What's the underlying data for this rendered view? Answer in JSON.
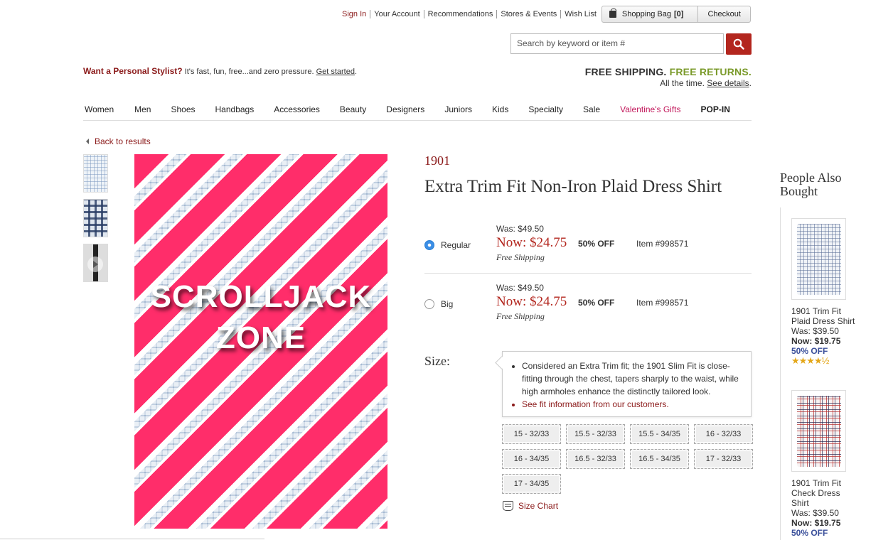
{
  "utility": {
    "links": [
      "Sign In",
      "Your Account",
      "Recommendations",
      "Stores & Events",
      "Wish List"
    ],
    "bag_label": "Shopping Bag",
    "bag_count": "[0]",
    "checkout_label": "Checkout"
  },
  "search": {
    "placeholder": "Search by keyword or item #"
  },
  "promo": {
    "stylist_bold": "Want a Personal Stylist?",
    "stylist_text": " It's fast, fun, free...and zero pressure. ",
    "stylist_link": "Get started",
    "stylist_end": ".",
    "ship_a": "FREE SHIPPING.",
    "ship_b": "FREE RETURNS.",
    "ship_sub": "All the time. ",
    "ship_link": "See details",
    "ship_end": "."
  },
  "nav": [
    "Women",
    "Men",
    "Shoes",
    "Handbags",
    "Accessories",
    "Beauty",
    "Designers",
    "Juniors",
    "Kids",
    "Specialty",
    "Sale",
    "Valentine's Gifts",
    "POP-IN"
  ],
  "back_label": "Back to results",
  "hero": {
    "line1": "SCROLLJACK",
    "line2": "ZONE"
  },
  "product": {
    "brand": "1901",
    "title": "Extra Trim Fit Non-Iron Plaid Dress Shirt",
    "options": [
      {
        "label": "Regular",
        "was": "Was: $49.50",
        "now": "Now: $24.75",
        "off": "50% OFF",
        "item": "Item #998571",
        "free": "Free Shipping",
        "selected": true
      },
      {
        "label": "Big",
        "was": "Was: $49.50",
        "now": "Now: $24.75",
        "off": "50% OFF",
        "item": "Item #998571",
        "free": "Free Shipping",
        "selected": false
      }
    ],
    "size_label": "Size:",
    "fit_note": "Considered an Extra Trim fit; the 1901 Slim Fit is close-fitting through the chest, tapers sharply to the waist, while high armholes enhance the distinctly tailored look.",
    "fit_link": "See fit information from our customers.",
    "sizes": [
      "15 - 32/33",
      "15.5 - 32/33",
      "15.5 - 34/35",
      "16 - 32/33",
      "16 - 34/35",
      "16.5 - 32/33",
      "16.5 - 34/35",
      "17 - 32/33",
      "17 - 34/35"
    ],
    "size_chart": "Size Chart"
  },
  "also_bought": {
    "title": "People Also Bought",
    "items": [
      {
        "name": "1901 Trim Fit Plaid Dress Shirt",
        "was": "Was: $39.50",
        "now_label": "Now:",
        "now": "$19.75",
        "off": "50% OFF",
        "stars": "★★★★½",
        "rating": 4.5
      },
      {
        "name": "1901 Trim Fit Check Dress Shirt",
        "was": "Was: $39.50",
        "now_label": "Now:",
        "now": "$19.75",
        "off": "50% OFF"
      }
    ]
  },
  "colors": {
    "accent": "#8b1a1a",
    "price": "#b3261e",
    "green": "#7a9a2a",
    "pink": "#c2185b",
    "hero_pink": "#ff2d6a",
    "radio": "#3b8ee6"
  }
}
